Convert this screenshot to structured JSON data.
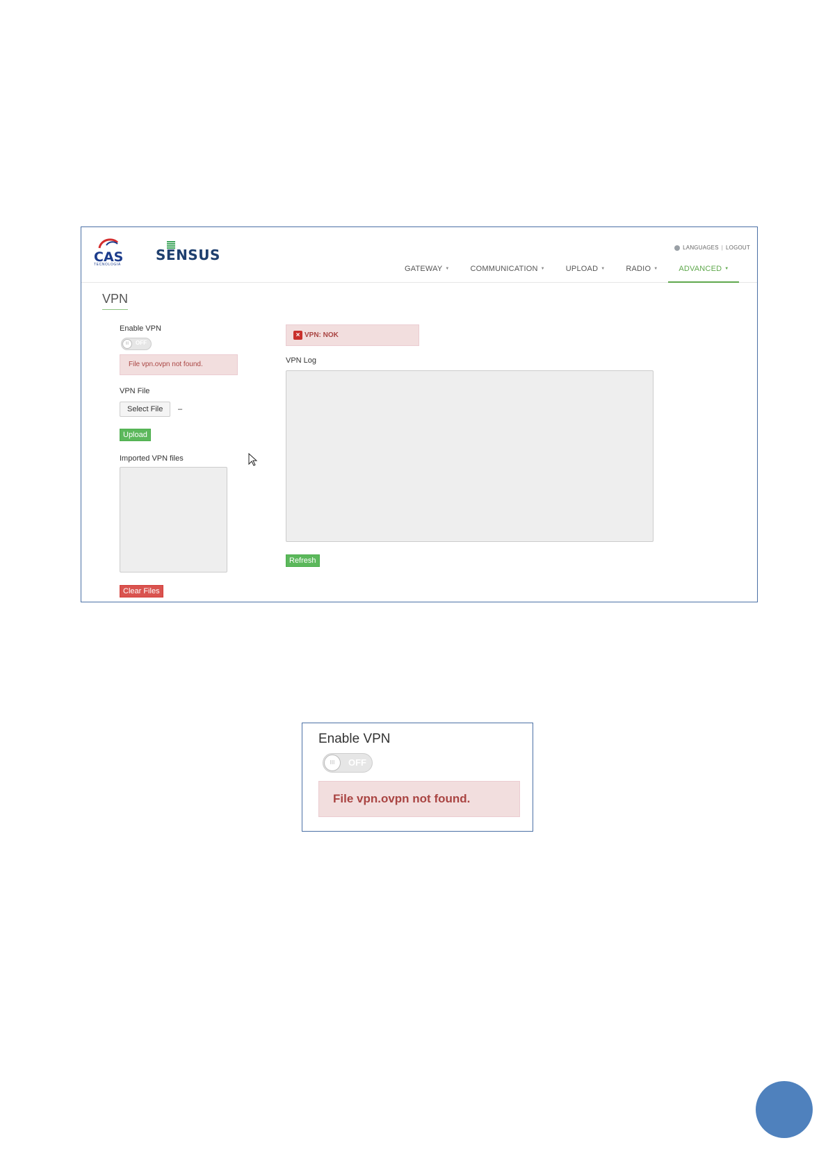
{
  "header": {
    "logo_cas": {
      "text": "CAS",
      "subtext": "TECNOLOGIA"
    },
    "logo_sensus": {
      "text": "SENSUS"
    },
    "links": {
      "languages": "LANGUAGES",
      "separator": "|",
      "logout": "LOGOUT"
    },
    "nav": [
      {
        "label": "GATEWAY"
      },
      {
        "label": "COMMUNICATION"
      },
      {
        "label": "UPLOAD"
      },
      {
        "label": "RADIO"
      },
      {
        "label": "ADVANCED"
      }
    ],
    "active_nav": "ADVANCED",
    "accent_color": "#5fa84c"
  },
  "page": {
    "title": "VPN",
    "enable_vpn": {
      "label": "Enable VPN",
      "toggle_state": "OFF",
      "toggle_icon": "III"
    },
    "file_error": "File vpn.ovpn not found.",
    "vpn_file": {
      "label": "VPN File",
      "select_label": "Select File",
      "selected_value": "–"
    },
    "upload_label": "Upload",
    "imported_label": "Imported VPN files",
    "clear_label": "Clear Files",
    "status": {
      "icon": "x-icon",
      "text": "VPN: NOK"
    },
    "log_label": "VPN Log",
    "refresh_label": "Refresh"
  },
  "zoom": {
    "label": "Enable VPN",
    "toggle_state": "OFF",
    "toggle_icon": "III",
    "error": "File vpn.ovpn not found."
  },
  "colors": {
    "success": "#5cb85c",
    "danger": "#d9534f",
    "alert_bg": "#f2dede",
    "alert_text": "#a94442",
    "frame_border": "#4a6fa5",
    "page_circle": "#4f81bd"
  }
}
